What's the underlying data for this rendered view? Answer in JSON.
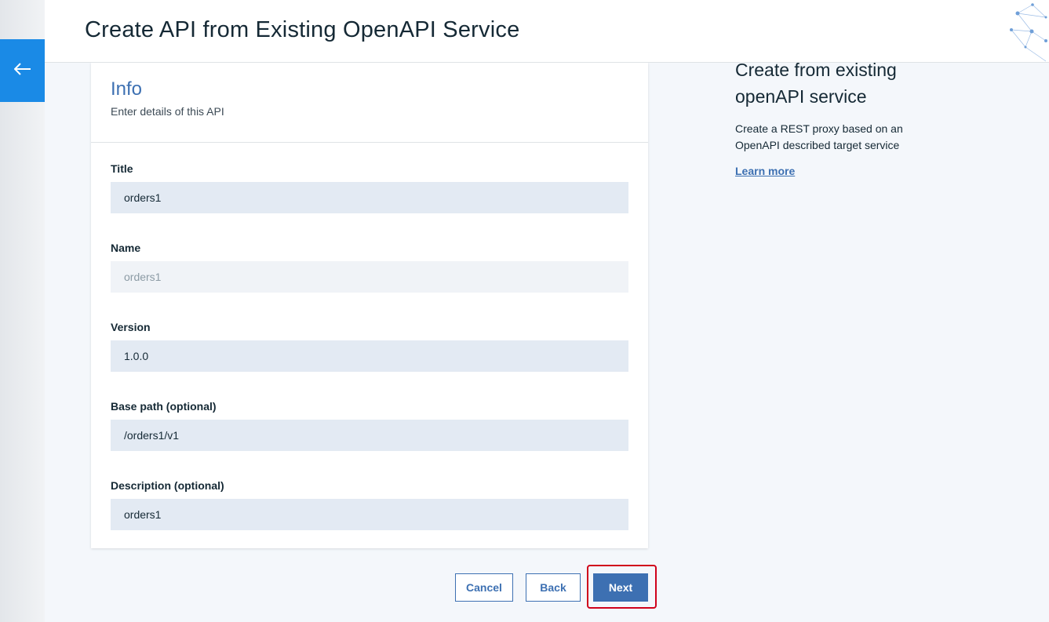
{
  "header": {
    "title": "Create API from Existing OpenAPI Service",
    "back_icon": "arrow-left-icon"
  },
  "card": {
    "title": "Info",
    "subtitle": "Enter details of this API"
  },
  "fields": {
    "title": {
      "label": "Title",
      "value": "orders1"
    },
    "name": {
      "label": "Name",
      "value": "orders1"
    },
    "version": {
      "label": "Version",
      "value": "1.0.0"
    },
    "base_path": {
      "label": "Base path (optional)",
      "value": "/orders1/v1"
    },
    "description": {
      "label": "Description (optional)",
      "value": "orders1"
    }
  },
  "buttons": {
    "cancel": "Cancel",
    "back": "Back",
    "next": "Next"
  },
  "side_panel": {
    "title": "Create from existing openAPI service",
    "text": "Create a REST proxy based on an OpenAPI described target service",
    "link": "Learn more"
  },
  "colors": {
    "accent": "#3d70b2",
    "back_button": "#1a8ae6",
    "highlight": "#d0021b"
  }
}
